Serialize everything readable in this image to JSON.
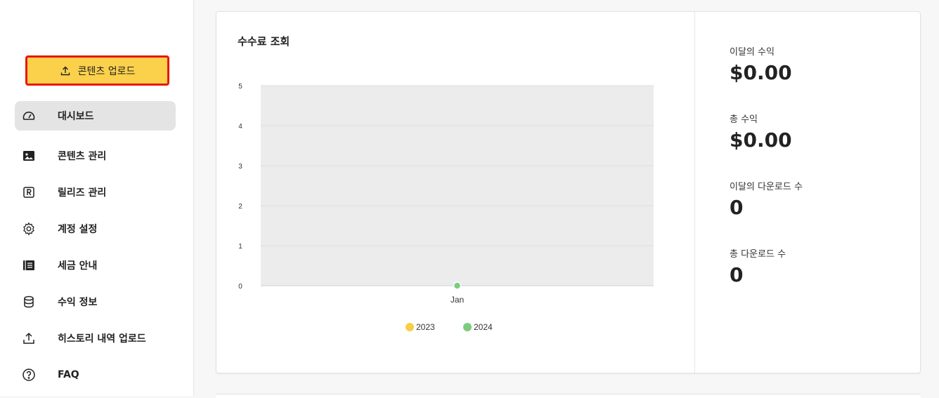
{
  "sidebar": {
    "upload_button_label": "콘텐츠 업로드",
    "items": [
      {
        "label": "대시보드",
        "icon": "dashboard-icon",
        "active": true
      },
      {
        "label": "콘텐츠 관리",
        "icon": "image-icon"
      },
      {
        "label": "릴리즈 관리",
        "icon": "release-icon"
      },
      {
        "label": "계정 설정",
        "icon": "gear-icon"
      },
      {
        "label": "세금 안내",
        "icon": "book-icon"
      },
      {
        "label": "수익 정보",
        "icon": "database-icon"
      },
      {
        "label": "히스토리 내역 업로드",
        "icon": "upload-icon"
      },
      {
        "label": "FAQ",
        "icon": "help-icon"
      }
    ]
  },
  "main": {
    "chart_title": "수수료 조회",
    "stats": [
      {
        "label": "이달의 수익",
        "value": "$0.00"
      },
      {
        "label": "총 수익",
        "value": "$0.00"
      },
      {
        "label": "이달의 다운로드 수",
        "value": "0"
      },
      {
        "label": "총 다운로드 수",
        "value": "0"
      }
    ]
  },
  "colors": {
    "accent": "#fbd04b",
    "highlight_border": "#e8170e",
    "series_2023": "#f7ce46",
    "series_2024": "#7dcb7f",
    "plot_bg": "#ececec"
  },
  "chart_data": {
    "type": "line",
    "x": [
      "Jan"
    ],
    "series": [
      {
        "name": "2023",
        "values": []
      },
      {
        "name": "2024",
        "values": [
          0
        ]
      }
    ],
    "ylim": [
      0,
      5
    ],
    "yticks": [
      "0",
      "1",
      "2",
      "3",
      "4",
      "5"
    ],
    "xticks": [
      "Jan"
    ],
    "grid": true,
    "legend": "bottom"
  }
}
